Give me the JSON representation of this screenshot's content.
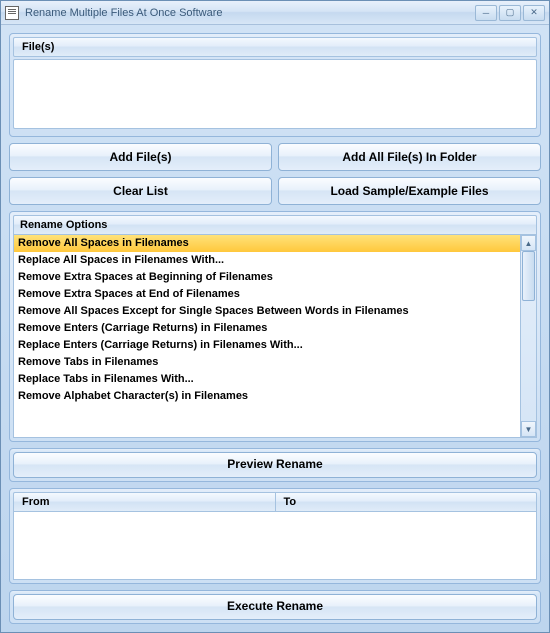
{
  "window": {
    "title": "Rename Multiple Files At Once Software"
  },
  "files": {
    "header": "File(s)"
  },
  "buttons": {
    "add_files": "Add File(s)",
    "add_folder": "Add All File(s) In Folder",
    "clear_list": "Clear List",
    "load_sample": "Load Sample/Example Files",
    "preview": "Preview Rename",
    "execute": "Execute Rename"
  },
  "options": {
    "header": "Rename Options",
    "selected_index": 0,
    "items": [
      "Remove All Spaces in Filenames",
      "Replace All Spaces in Filenames With...",
      "Remove Extra Spaces at Beginning of Filenames",
      "Remove Extra Spaces at End of Filenames",
      "Remove All Spaces Except for Single Spaces Between Words in Filenames",
      "Remove Enters (Carriage Returns) in Filenames",
      "Replace Enters (Carriage Returns) in Filenames With...",
      "Remove Tabs in Filenames",
      "Replace Tabs in Filenames With...",
      "Remove Alphabet Character(s) in Filenames"
    ]
  },
  "preview": {
    "from_header": "From",
    "to_header": "To"
  }
}
